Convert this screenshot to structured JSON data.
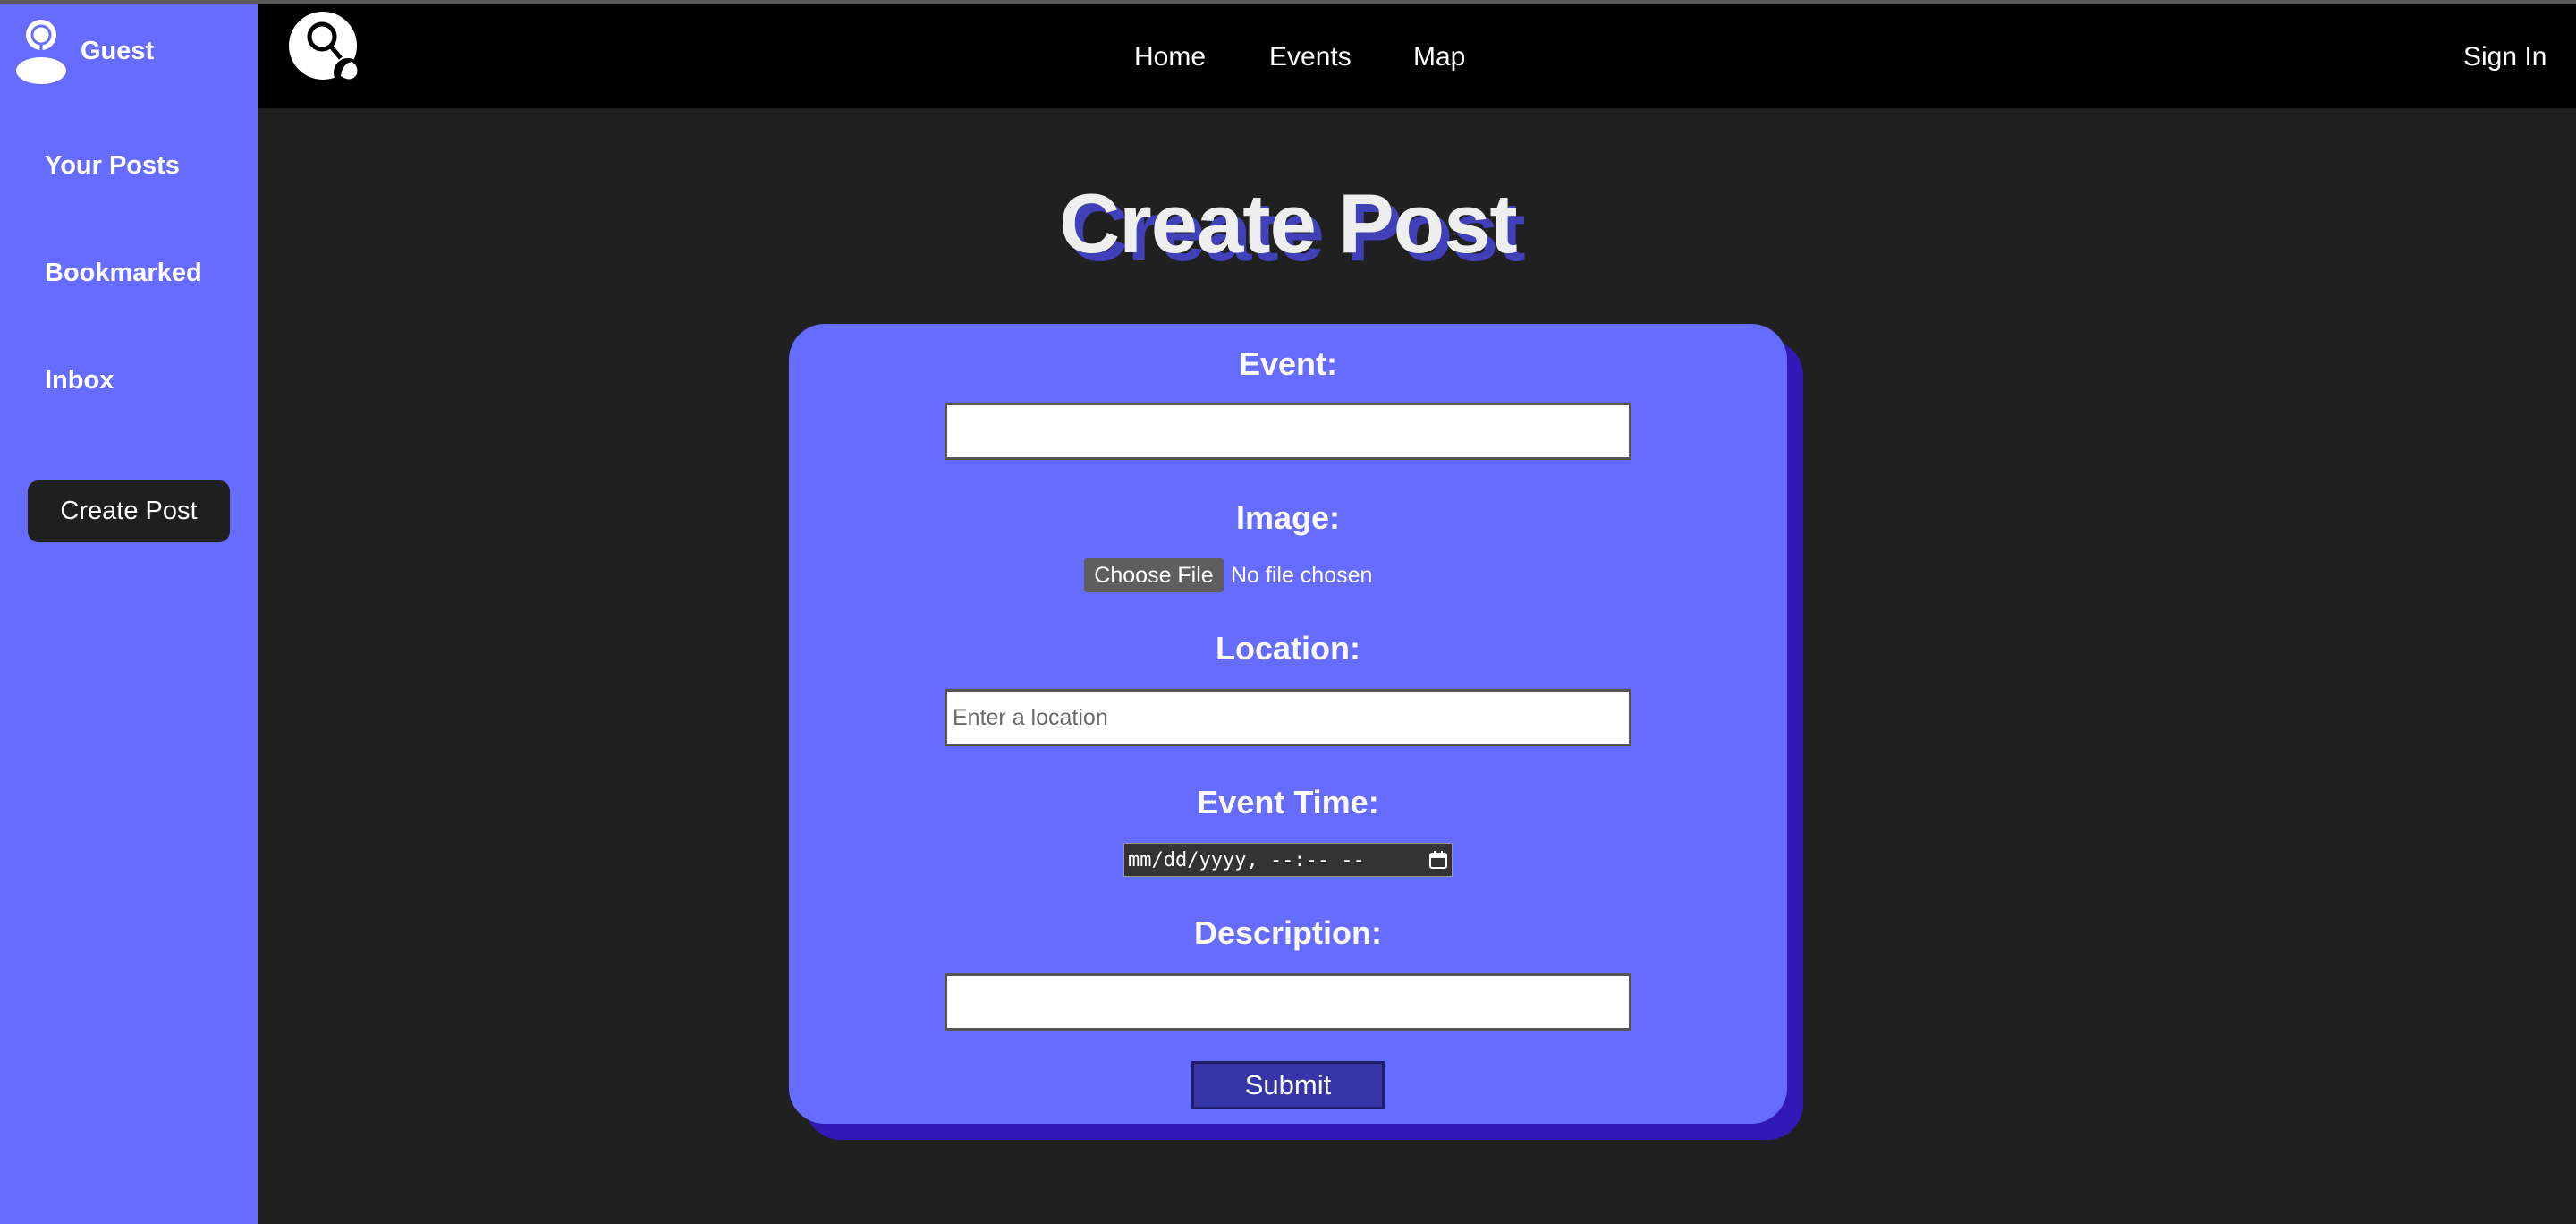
{
  "sidebar": {
    "user_name": "Guest",
    "items": [
      {
        "label": "Your Posts"
      },
      {
        "label": "Bookmarked"
      },
      {
        "label": "Inbox"
      }
    ],
    "create_button": "Create Post"
  },
  "nav": {
    "links": [
      {
        "label": "Home"
      },
      {
        "label": "Events"
      },
      {
        "label": "Map"
      }
    ],
    "sign_in": "Sign In"
  },
  "page_title": "Create Post",
  "form": {
    "event_label": "Event:",
    "event_value": "",
    "image_label": "Image:",
    "file_button": "Choose File",
    "file_status": "No file chosen",
    "location_label": "Location:",
    "location_placeholder": "Enter a location",
    "time_label": "Event Time:",
    "time_placeholder": "mm/dd/yyyy, --:-- --",
    "description_label": "Description:",
    "description_value": "",
    "submit": "Submit"
  },
  "colors": {
    "sidebar": "#666cff",
    "card": "#666cff",
    "card_shadow": "#3318b8",
    "background": "#202020",
    "nav": "#000000",
    "submit": "#3535a8"
  },
  "icons": {
    "user": "user-avatar-icon",
    "logo": "search-person-logo-icon",
    "calendar": "calendar-icon"
  }
}
